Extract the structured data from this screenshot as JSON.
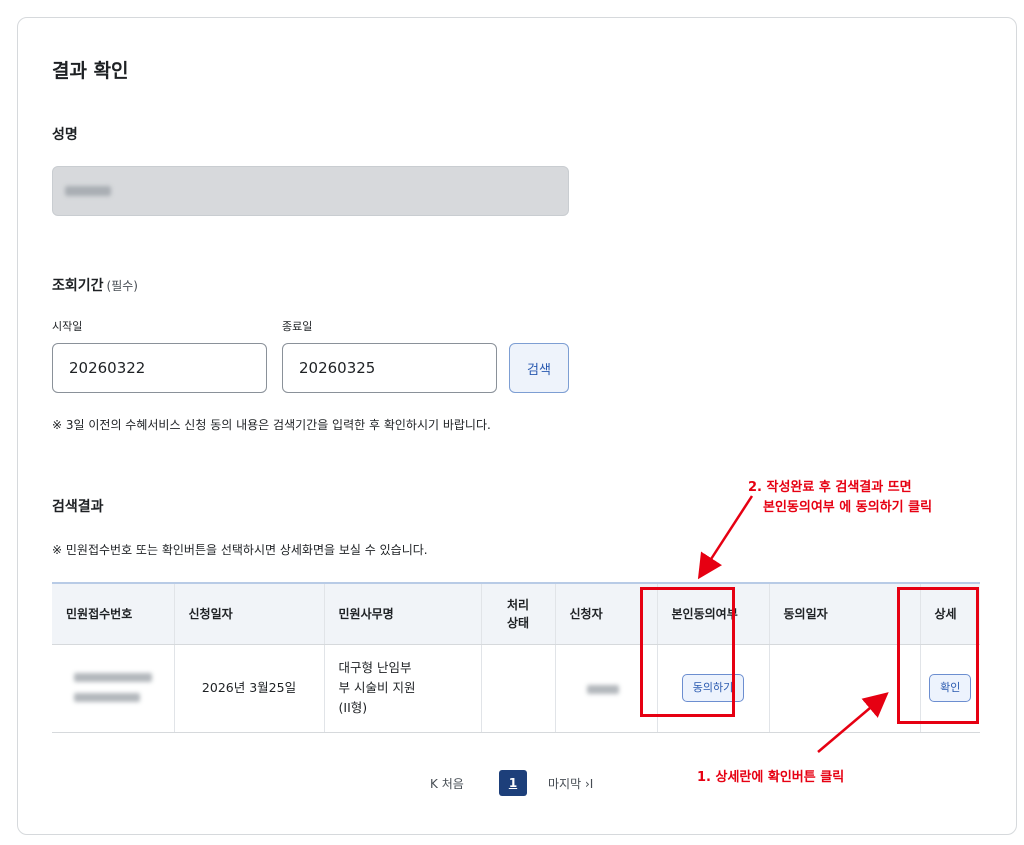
{
  "page": {
    "title": "결과 확인"
  },
  "name_section": {
    "label": "성명"
  },
  "period_section": {
    "label": "조회기간",
    "required_note": "(필수)",
    "start_label": "시작일",
    "start_value": "20260322",
    "end_label": "종료일",
    "end_value": "20260325",
    "search_button": "검색",
    "notice": "※ 3일 이전의 수혜서비스 신청 동의 내용은 검색기간을 입력한 후 확인하시기 바랍니다."
  },
  "results_section": {
    "label": "검색결과",
    "notice": "※ 민원접수번호 또는 확인버튼을 선택하시면 상세화면을 보실 수 있습니다.",
    "columns": [
      "민원접수번호",
      "신청일자",
      "민원사무명",
      "처리\n상태",
      "신청자",
      "본인동의여부",
      "동의일자",
      "상세"
    ],
    "rows": [
      {
        "date": "2026년 3월25일",
        "service": "대구형 난임부\n부 시술비 지원\n(II형)",
        "status": "",
        "consent_button": "동의하기",
        "consent_date": "",
        "detail_button": "확인"
      }
    ]
  },
  "pagination": {
    "first": "처음",
    "current": "1",
    "last": "마지막"
  },
  "annotations": {
    "step1": "1. 상세란에 확인버튼 클릭",
    "step2_line1": "2. 작성완료 후 검색결과 뜨면",
    "step2_line2": "본인동의여부 에 동의하기 클릭"
  },
  "colors": {
    "annotation_red": "#e60012",
    "pagination_active": "#1d3f7a",
    "button_blue": "#2a5ab0"
  }
}
